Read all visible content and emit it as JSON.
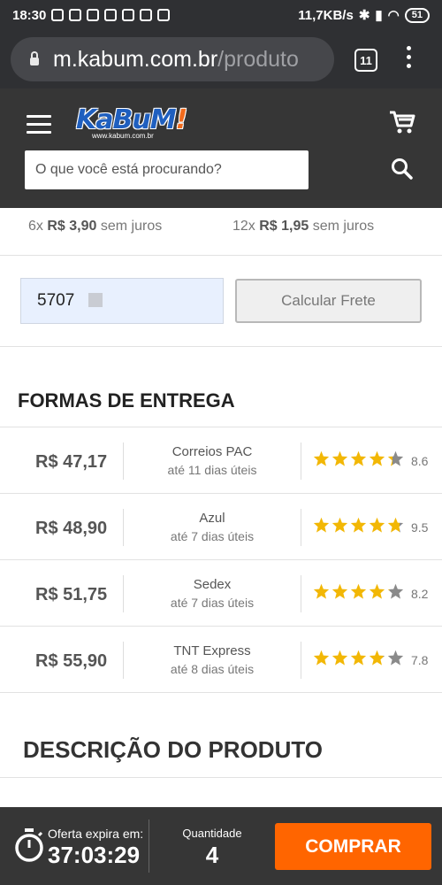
{
  "statusbar": {
    "time": "18:30",
    "net_speed": "11,7KB/s",
    "battery": "51"
  },
  "browser": {
    "url_host": "m.kabum.com.br",
    "url_path": "/produto",
    "tabs_count": "11"
  },
  "header": {
    "logo_text_main": "KaBuM",
    "logo_text_bang": "!",
    "logo_sub": "www.kabum.com.br",
    "search_placeholder": "O que você está procurando?"
  },
  "installments": [
    {
      "count": "6x",
      "price": "R$ 3,90",
      "suffix": "sem juros"
    },
    {
      "count": "12x",
      "price": "R$ 1,95",
      "suffix": "sem juros"
    }
  ],
  "frete": {
    "cep_value": "5707",
    "button_label": "Calcular Frete"
  },
  "entrega": {
    "title": "FORMAS DE ENTREGA",
    "options": [
      {
        "price": "R$ 47,17",
        "carrier": "Correios PAC",
        "deadline": "até 11 dias úteis",
        "rating": 8.6,
        "score": "8.6"
      },
      {
        "price": "R$ 48,90",
        "carrier": "Azul",
        "deadline": "até 7 dias úteis",
        "rating": 9.5,
        "score": "9.5"
      },
      {
        "price": "R$ 51,75",
        "carrier": "Sedex",
        "deadline": "até 7 dias úteis",
        "rating": 8.2,
        "score": "8.2"
      },
      {
        "price": "R$ 55,90",
        "carrier": "TNT Express",
        "deadline": "até 8 dias úteis",
        "rating": 7.8,
        "score": "7.8"
      }
    ]
  },
  "descricao": {
    "title": "DESCRIÇÃO DO PRODUTO"
  },
  "bottombar": {
    "offer_label": "Oferta expira em:",
    "offer_timer": "37:03:29",
    "qty_label": "Quantidade",
    "qty_value": "4",
    "buy_label": "COMPRAR"
  },
  "colors": {
    "accent": "#ff6500",
    "star": "#f2b705",
    "header_bg": "#363636",
    "statusbar_bg": "#2f3033"
  }
}
